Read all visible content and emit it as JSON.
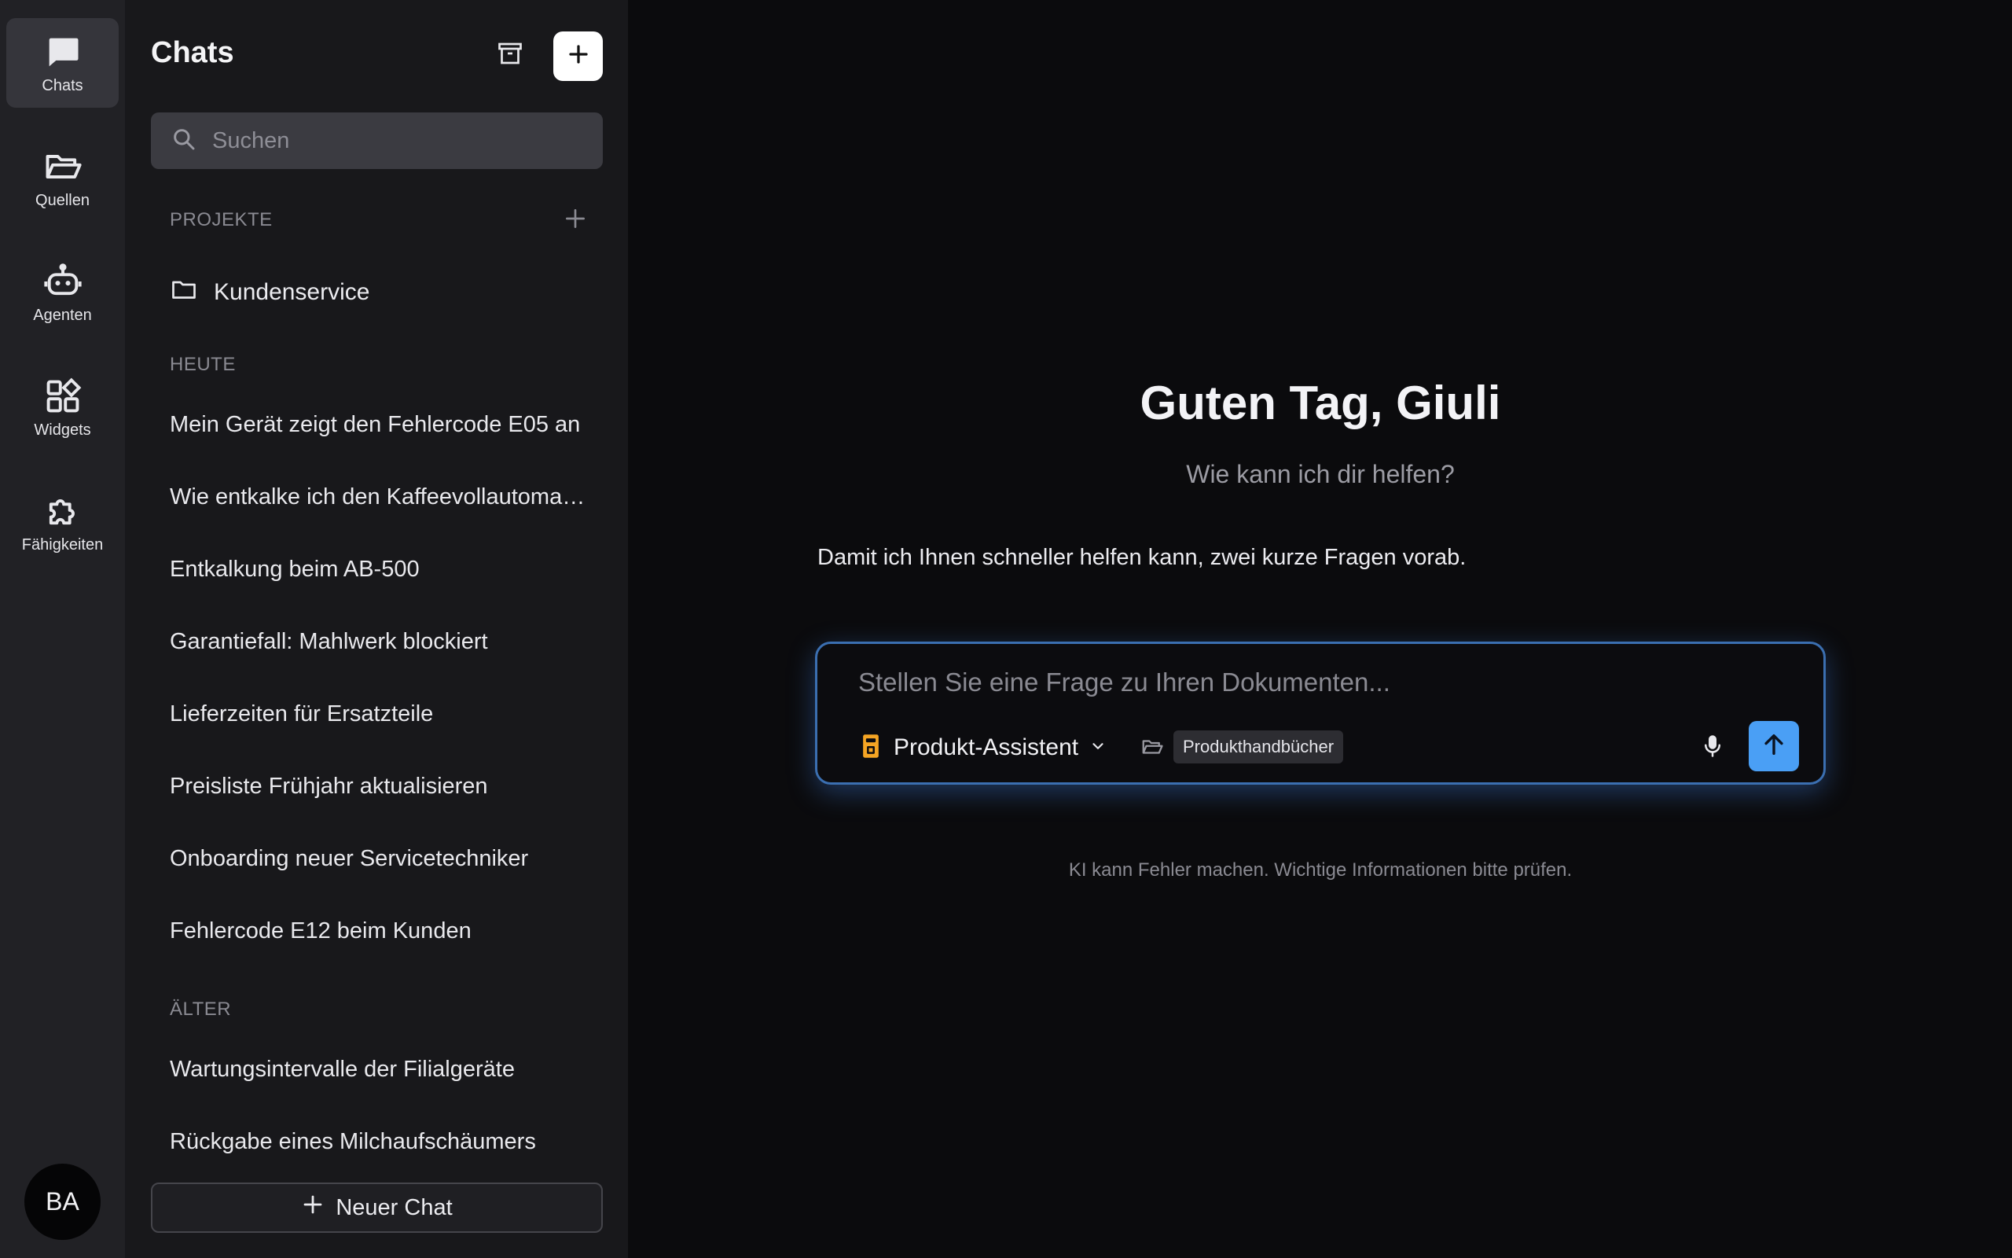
{
  "rail": {
    "items": [
      {
        "label": "Chats",
        "icon": "chat-bubble-icon"
      },
      {
        "label": "Quellen",
        "icon": "folder-open-icon"
      },
      {
        "label": "Agenten",
        "icon": "robot-icon"
      },
      {
        "label": "Widgets",
        "icon": "widgets-icon"
      },
      {
        "label": "Fähigkeiten",
        "icon": "puzzle-icon"
      }
    ],
    "avatar_initials": "BA"
  },
  "panel": {
    "title": "Chats",
    "search_placeholder": "Suchen",
    "projects_heading": "PROJEKTE",
    "projects": [
      "Kundenservice"
    ],
    "today_heading": "HEUTE",
    "today_chats": [
      "Mein Gerät zeigt den Fehlercode E05 an",
      "Wie entkalke ich den Kaffeevollautomaten?",
      "Entkalkung beim AB-500",
      "Garantiefall: Mahlwerk blockiert",
      "Lieferzeiten für Ersatzteile",
      "Preisliste Frühjahr aktualisieren",
      "Onboarding neuer Servicetechniker",
      "Fehlercode E12 beim Kunden"
    ],
    "older_heading": "ÄLTER",
    "older_chats": [
      "Wartungsintervalle der Filialgeräte",
      "Rückgabe eines Milchaufschäumers"
    ],
    "new_chat_label": "Neuer Chat"
  },
  "main": {
    "greeting": "Guten Tag, Giuli",
    "subgreeting": "Wie kann ich dir helfen?",
    "intro": "Damit ich Ihnen schneller helfen kann, zwei kurze Fragen vorab.",
    "composer_placeholder": "Stellen Sie eine Frage zu Ihren Dokumenten...",
    "agent_name": "Produkt-Assistent",
    "source_tag": "Produkthandbücher",
    "disclaimer": "KI kann Fehler machen. Wichtige Informationen bitte prüfen."
  },
  "colors": {
    "accent": "#4a9ff5",
    "composer_border": "#3b6fb1",
    "agent_icon": "#f5a524"
  }
}
